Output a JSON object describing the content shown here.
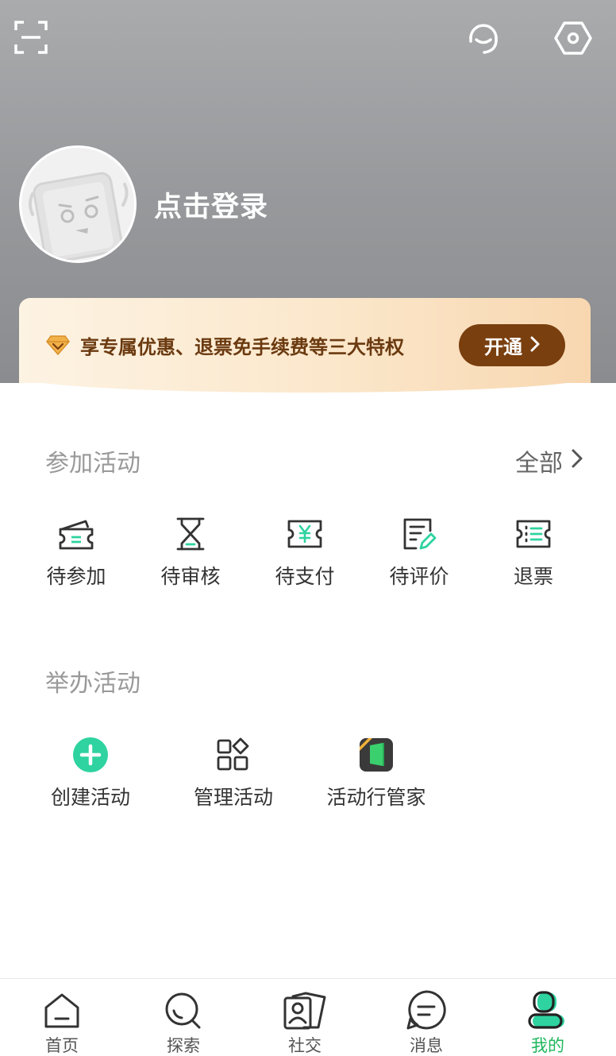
{
  "user": {
    "login_prompt": "点击登录"
  },
  "vip": {
    "benefit_text": "享专属优惠、退票免手续费等三大特权",
    "button_label": "开通"
  },
  "join_activities": {
    "title": "参加活动",
    "see_all": "全部",
    "items": [
      {
        "label": "待参加",
        "icon": "ticket-icon"
      },
      {
        "label": "待审核",
        "icon": "hourglass-icon"
      },
      {
        "label": "待支付",
        "icon": "payment-icon"
      },
      {
        "label": "待评价",
        "icon": "review-icon"
      },
      {
        "label": "退票",
        "icon": "refund-icon"
      }
    ]
  },
  "host_activities": {
    "title": "举办活动",
    "items": [
      {
        "label": "创建活动",
        "icon": "plus-circle-icon"
      },
      {
        "label": "管理活动",
        "icon": "apps-icon"
      },
      {
        "label": "活动行管家",
        "icon": "manager-app-icon"
      }
    ]
  },
  "tabbar": {
    "items": [
      {
        "label": "首页",
        "icon": "home-icon"
      },
      {
        "label": "探索",
        "icon": "search-icon"
      },
      {
        "label": "社交",
        "icon": "contacts-icon"
      },
      {
        "label": "消息",
        "icon": "message-icon"
      },
      {
        "label": "我的",
        "icon": "profile-icon",
        "active": true
      }
    ]
  },
  "colors": {
    "accent": "#1fb75e",
    "teal": "#2ed3a0",
    "vip_brown": "#7a3f0f"
  }
}
